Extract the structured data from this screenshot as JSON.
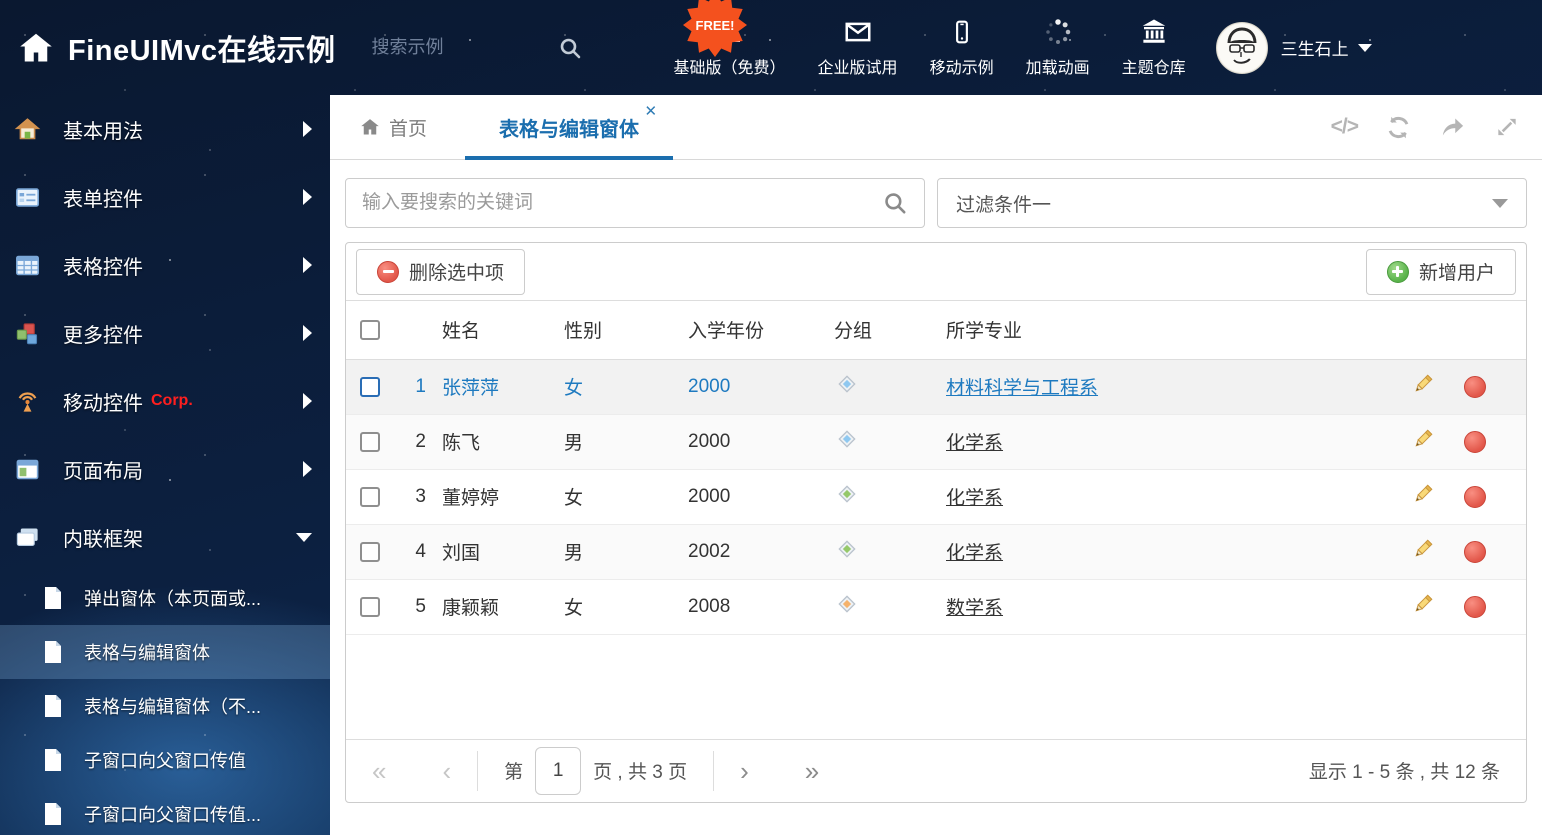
{
  "colors": {
    "accent": "#1b6eae",
    "link_blue": "#1e7ac0",
    "danger_red": "#e2574a",
    "success_green": "#59b34a",
    "free_badge_orange": "#f4511e",
    "corp_red": "#ff1f1f"
  },
  "header": {
    "title": "FineUIMvc在线示例",
    "search_placeholder": "搜索示例",
    "free_badge": "FREE!",
    "menu": [
      {
        "icon": "download-icon",
        "label": "基础版（免费）"
      },
      {
        "icon": "envelope-icon",
        "label": "企业版试用"
      },
      {
        "icon": "mobile-icon",
        "label": "移动示例"
      },
      {
        "icon": "spinner-icon",
        "label": "加载动画"
      },
      {
        "icon": "bank-icon",
        "label": "主题仓库"
      }
    ],
    "user": {
      "name": "三生石上"
    }
  },
  "sidebar": {
    "items": [
      {
        "label": "基本用法",
        "icon": "home"
      },
      {
        "label": "表单控件",
        "icon": "form"
      },
      {
        "label": "表格控件",
        "icon": "table"
      },
      {
        "label": "更多控件",
        "icon": "cubes"
      },
      {
        "label": "移动控件",
        "badge": "Corp.",
        "icon": "antenna"
      },
      {
        "label": "页面布局",
        "icon": "layout"
      },
      {
        "label": "内联框架",
        "icon": "frames",
        "expanded": true
      }
    ],
    "children": [
      {
        "label": "弹出窗体（本页面或..."
      },
      {
        "label": "表格与编辑窗体",
        "active": true
      },
      {
        "label": "表格与编辑窗体（不..."
      },
      {
        "label": "子窗口向父窗口传值"
      },
      {
        "label": "子窗口向父窗口传值..."
      }
    ]
  },
  "tabs": {
    "home": "首页",
    "active": "表格与编辑窗体",
    "close": "✕"
  },
  "filters": {
    "search_placeholder": "输入要搜索的关键词",
    "filter_value": "过滤条件一"
  },
  "toolbar": {
    "delete_label": "删除选中项",
    "add_label": "新增用户"
  },
  "table": {
    "headers": {
      "name": "姓名",
      "gender": "性别",
      "year": "入学年份",
      "group": "分组",
      "major": "所学专业"
    },
    "rows": [
      {
        "num": "1",
        "name": "张萍萍",
        "gender": "女",
        "year": "2000",
        "tag_color": "#8fc8f0",
        "major": "材料科学与工程系",
        "selected": true
      },
      {
        "num": "2",
        "name": "陈飞",
        "gender": "男",
        "year": "2000",
        "tag_color": "#8fc8f0",
        "major": "化学系"
      },
      {
        "num": "3",
        "name": "董婷婷",
        "gender": "女",
        "year": "2000",
        "tag_color": "#95c86a",
        "major": "化学系"
      },
      {
        "num": "4",
        "name": "刘国",
        "gender": "男",
        "year": "2002",
        "tag_color": "#95c86a",
        "major": "化学系"
      },
      {
        "num": "5",
        "name": "康颖颖",
        "gender": "女",
        "year": "2008",
        "tag_color": "#f5b26b",
        "major": "数学系"
      }
    ]
  },
  "pager": {
    "first": "«",
    "prev": "‹",
    "next": "›",
    "last": "»",
    "prefix": "第",
    "page": "1",
    "suffix": "页 , 共 3 页",
    "summary": "显示 1 - 5 条 , 共 12 条"
  }
}
